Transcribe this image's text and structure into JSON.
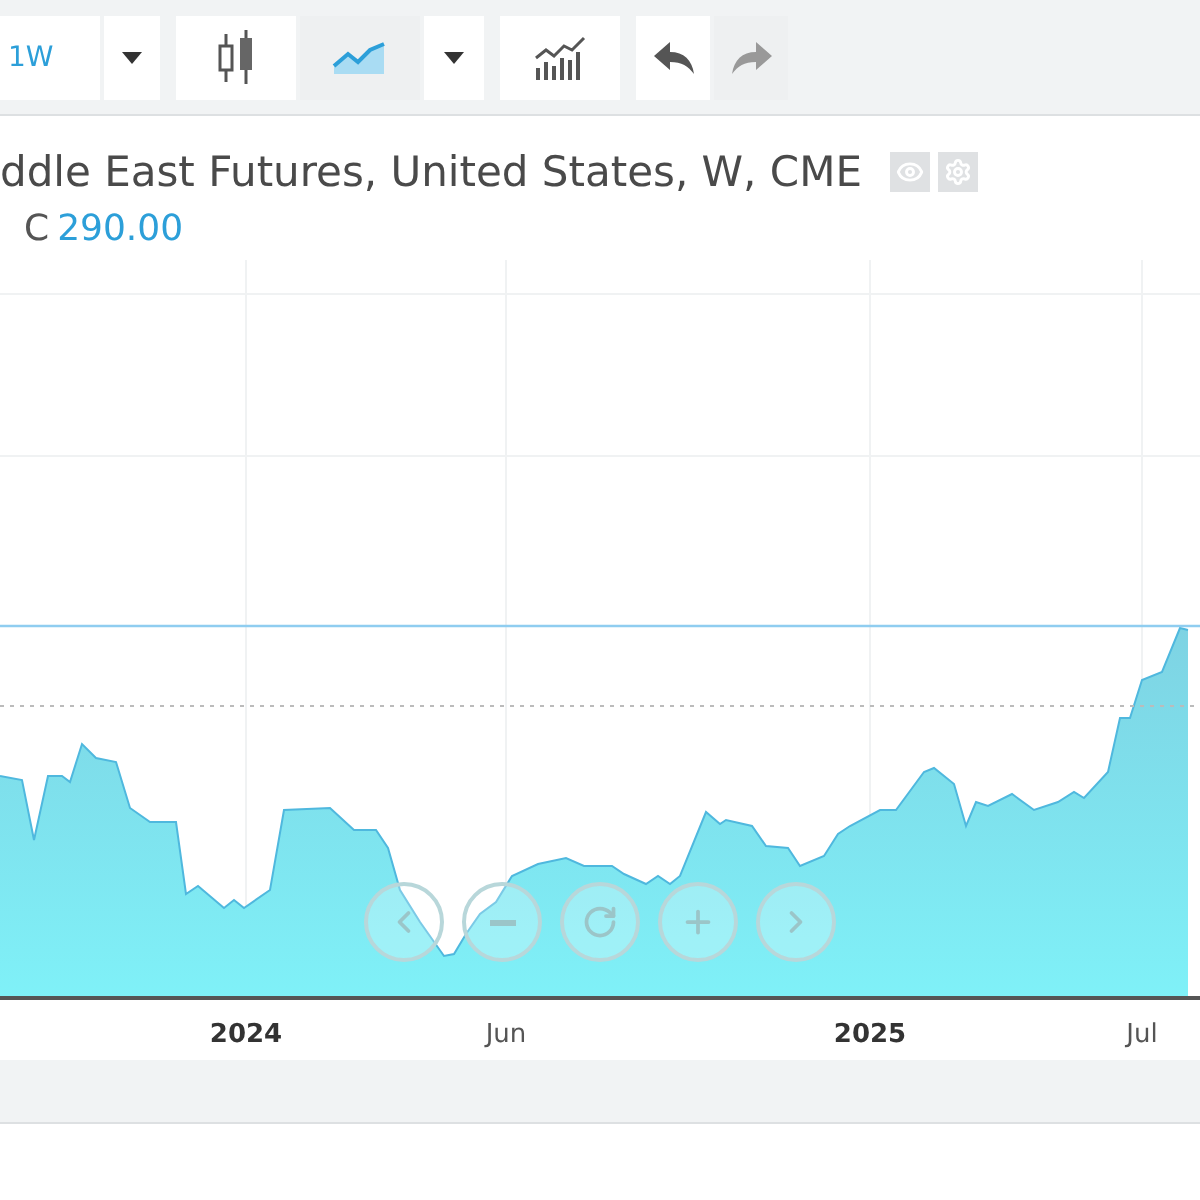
{
  "toolbar": {
    "interval": "1W",
    "chart_types": [
      {
        "kind": "candles",
        "selected": false
      },
      {
        "kind": "area",
        "selected": true
      }
    ],
    "history": [
      {
        "kind": "undo",
        "disabled": false
      },
      {
        "kind": "redo",
        "disabled": true
      }
    ]
  },
  "legend": {
    "title": "ddle East Futures, United States, W, CME",
    "close_label": "C",
    "close_value": "290.00"
  },
  "x_axis": [
    {
      "label": "2024",
      "kind": "year"
    },
    {
      "label": "Jun",
      "kind": "month"
    },
    {
      "label": "2025",
      "kind": "year"
    },
    {
      "label": "Jul",
      "kind": "month"
    }
  ],
  "zoom_controls": [
    {
      "kind": "back"
    },
    {
      "kind": "zoom_out"
    },
    {
      "kind": "reset"
    },
    {
      "kind": "zoom_in"
    },
    {
      "kind": "forward"
    }
  ]
}
